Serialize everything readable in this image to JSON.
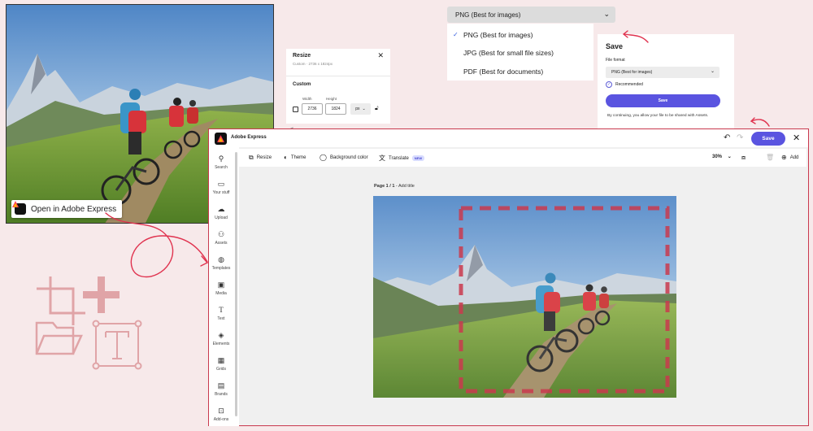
{
  "thumbnail": {
    "open_label": "Open in Adobe Express"
  },
  "resize_panel": {
    "title": "Resize",
    "subtitle": "Custom · 2736 x 1824px",
    "section": "Custom",
    "width_label": "Width",
    "height_label": "Height",
    "width_value": "2736",
    "height_value": "1824",
    "unit": "px"
  },
  "format_dropdown": {
    "selected": "PNG (Best for images)",
    "options": [
      "PNG (Best for images)",
      "JPG (Best for small file sizes)",
      "PDF (Best for documents)"
    ]
  },
  "save_panel": {
    "title": "Save",
    "file_format_label": "File format",
    "file_format_value": "PNG (Best for images)",
    "recommended": "Recommended",
    "save_button": "Save",
    "note": "By continuing, you allow your file to be shared with Assets."
  },
  "editor": {
    "app_name": "Adobe Express",
    "save_label": "Save",
    "toolbar": {
      "resize": "Resize",
      "theme": "Theme",
      "background": "Background color",
      "translate": "Translate",
      "new_badge": "NEW",
      "zoom": "30%",
      "add": "Add"
    },
    "rail": [
      "Search",
      "Your stuff",
      "Upload",
      "Assets",
      "Templates",
      "Media",
      "Text",
      "Elements",
      "Grids",
      "Brands",
      "Add-ons"
    ],
    "page_label": "Page 1 / 1",
    "page_title_placeholder": " - Add title"
  },
  "colors": {
    "accent": "#5a54e0",
    "annotation": "#e0334f",
    "background": "#f7e9ea"
  }
}
